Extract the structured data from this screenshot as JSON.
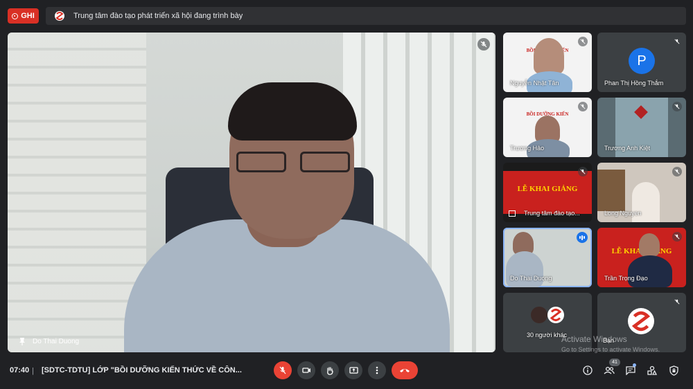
{
  "recording": {
    "label": "GHI"
  },
  "presentation": {
    "text": "Trung tâm đào tạo phát triển xã hội đang trình bày"
  },
  "main_speaker": {
    "name": "Do Thai Duong"
  },
  "tiles": [
    {
      "name": "Nguyễn Nhật Tân",
      "muted": true
    },
    {
      "name": "Phan Thị Hồng Thắm",
      "initial": "P",
      "muted": true
    },
    {
      "name": "Trương Hảo",
      "muted": true
    },
    {
      "name": "Trương Anh Kiệt",
      "muted": true
    },
    {
      "name": "Trung tâm đào tạo...",
      "muted": true
    },
    {
      "name": "Long Nguyen",
      "muted": true
    },
    {
      "name": "Do Thai Duong",
      "speaking": true
    },
    {
      "name": "Trần Trọng Đạo",
      "muted": true
    },
    {
      "name": "30 người khác"
    },
    {
      "name": "Bạn",
      "muted": true
    }
  ],
  "slides": {
    "le_khai_giang": "LỄ KHAI GIẢNG",
    "boi_duong": "BỒI DƯỠNG KIẾN"
  },
  "watermark": {
    "line1": "Activate Windows",
    "line2": "Go to Settings to activate Windows."
  },
  "bottom_bar": {
    "time": "07:40",
    "separator": "|",
    "meeting_title": "[SDTC-TDTU] LỚP \"BỒI DƯỠNG KIẾN THỨC VỀ CÔN...",
    "participant_count": "41"
  },
  "colors": {
    "background": "#202124",
    "record_red": "#d93025",
    "end_call": "#ea4335",
    "accent_blue": "#1a73e8"
  }
}
